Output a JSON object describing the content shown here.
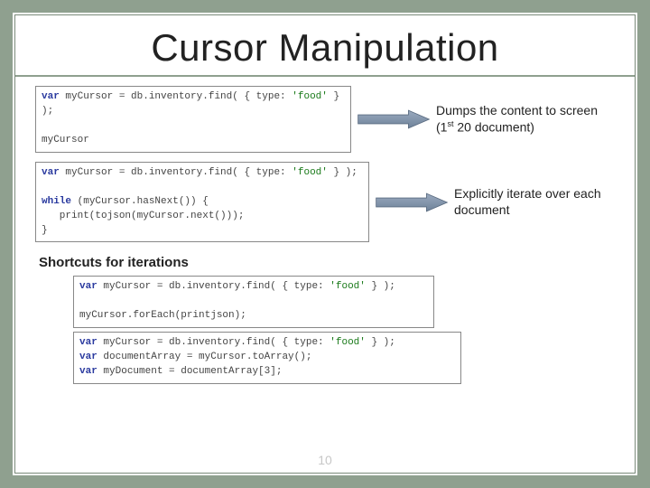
{
  "slide": {
    "title": "Cursor Manipulation",
    "page_number": "10"
  },
  "block1": {
    "code_line1_pre": "var",
    "code_line1_rest": " myCursor = db.inventory.find( { type: ",
    "code_line1_str": "'food'",
    "code_line1_end": " } );",
    "code_line2": "myCursor",
    "annot_a": "Dumps the content to screen (1",
    "annot_sup": "st",
    "annot_b": " 20 document)"
  },
  "block2": {
    "l1_pre": "var",
    "l1_rest": " myCursor = db.inventory.find( { type: ",
    "l1_str": "'food'",
    "l1_end": " } );",
    "l2_pre": "while",
    "l2_rest": " (myCursor.hasNext()) {",
    "l3": "   print(tojson(myCursor.next()));",
    "l4": "}",
    "annot": "Explicitly iterate over each document"
  },
  "shortcuts_heading": "Shortcuts for iterations",
  "block3": {
    "l1_pre": "var",
    "l1_rest": " myCursor =  db.inventory.find( { type: ",
    "l1_str": "'food'",
    "l1_end": " } );",
    "l2": "myCursor.forEach(printjson);"
  },
  "block4": {
    "l1_pre": "var",
    "l1_rest": " myCursor = db.inventory.find( { type: ",
    "l1_str": "'food'",
    "l1_end": " } );",
    "l2_pre": "var",
    "l2_rest": " documentArray = myCursor.toArray();",
    "l3_pre": "var",
    "l3_rest": " myDocument = documentArray[3];"
  }
}
